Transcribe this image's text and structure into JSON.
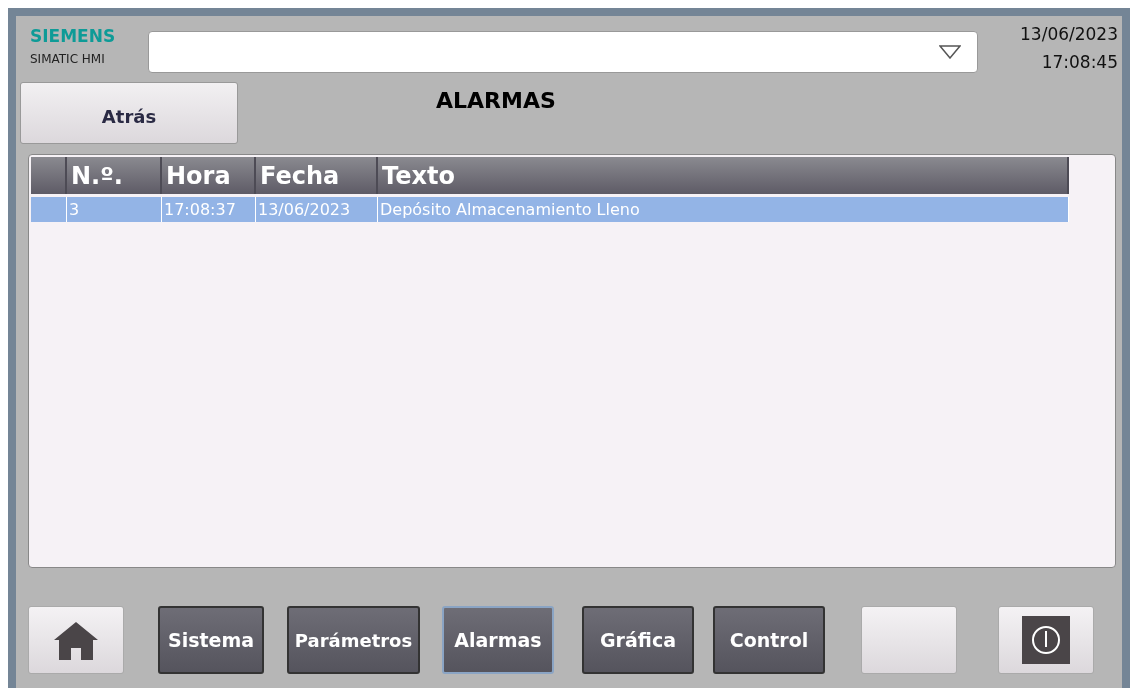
{
  "brand": {
    "logo": "SIEMENS",
    "product": "SIMATIC HMI"
  },
  "date": "13/06/2023",
  "time": "17:08:45",
  "back_button": "Atrás",
  "title": "ALARMAS",
  "table": {
    "columns": [
      "N.º.",
      "Hora",
      "Fecha",
      "Texto"
    ],
    "rows": [
      {
        "cells": [
          "3",
          "17:08:37",
          "13/06/2023",
          "Depósito Almacenamiento Lleno"
        ],
        "selected": true
      }
    ]
  },
  "nav": [
    {
      "kind": "home",
      "selected": false
    },
    {
      "kind": "text",
      "label": "Sistema",
      "selected": false
    },
    {
      "kind": "text",
      "label": "Parámetros",
      "selected": false
    },
    {
      "kind": "text",
      "label": "Alarmas",
      "selected": true
    },
    {
      "kind": "text",
      "label": "Gráfica",
      "selected": false
    },
    {
      "kind": "text",
      "label": "Control",
      "selected": false
    },
    {
      "kind": "blank",
      "selected": false
    },
    {
      "kind": "power",
      "selected": false
    }
  ]
}
